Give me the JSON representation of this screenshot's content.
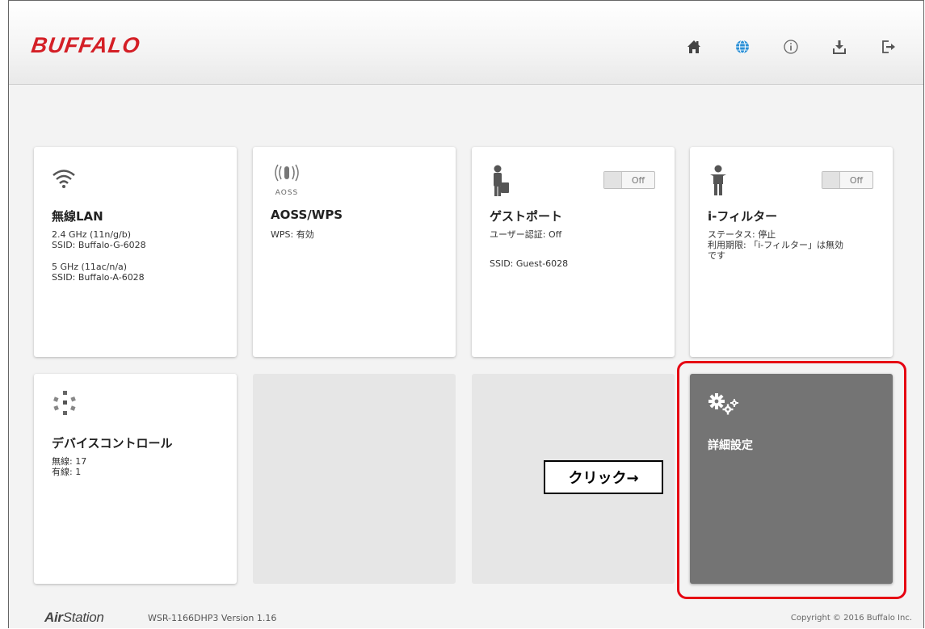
{
  "header": {
    "logo": "BUFFALO",
    "nav": [
      {
        "name": "home",
        "icon": "home-icon"
      },
      {
        "name": "internet",
        "icon": "globe-icon"
      },
      {
        "name": "info",
        "icon": "info-icon"
      },
      {
        "name": "download",
        "icon": "download-icon"
      },
      {
        "name": "logout",
        "icon": "logout-icon"
      }
    ]
  },
  "tiles": {
    "wireless": {
      "title": "無線LAN",
      "lines1": [
        "2.4 GHz (11n/g/b)",
        "SSID: Buffalo-G-6028"
      ],
      "lines2": [
        "5 GHz (11ac/n/a)",
        "SSID: Buffalo-A-6028"
      ]
    },
    "aoss": {
      "icon_label": "AOSS",
      "title": "AOSS/WPS",
      "line": "WPS: 有効"
    },
    "guest": {
      "title": "ゲストポート",
      "toggle": "Off",
      "line1": "ユーザー認証: Off",
      "line2": "SSID: Guest-6028"
    },
    "ifilter": {
      "title": "i-フィルター",
      "toggle": "Off",
      "lines": [
        "ステータス: 停止",
        "利用期限: 「i-フィルター」は無効",
        "です"
      ]
    },
    "device": {
      "title": "デバイスコントロール",
      "lines": [
        "無線: 17",
        "有線: 1"
      ]
    },
    "advanced": {
      "title": "詳細設定"
    }
  },
  "annotation": {
    "callout": "クリック→",
    "highlight_color": "#e60012"
  },
  "footer": {
    "brand_bold": "Air",
    "brand_rest": "Station",
    "model": "WSR-1166DHP3 Version 1.16",
    "copyright": "Copyright © 2016 Buffalo Inc."
  },
  "colors": {
    "logo": "#d41f26",
    "globe": "#2a8fd6",
    "dark_tile": "#747474"
  }
}
